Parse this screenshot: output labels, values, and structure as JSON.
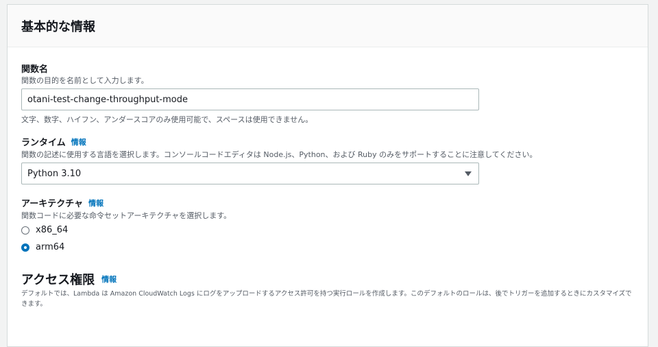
{
  "basic_info": {
    "title": "基本的な情報"
  },
  "function_name": {
    "label": "関数名",
    "description": "関数の目的を名前として入力します。",
    "value": "otani-test-change-throughput-mode",
    "constraint": "文字、数字、ハイフン、アンダースコアのみ使用可能で、スペースは使用できません。"
  },
  "runtime": {
    "label": "ランタイム",
    "info_link": "情報",
    "description": "関数の記述に使用する言語を選択します。コンソールコードエディタは Node.js、Python、および Ruby のみをサポートすることに注意してください。",
    "selected": "Python 3.10"
  },
  "architecture": {
    "label": "アーキテクチャ",
    "info_link": "情報",
    "description": "関数コードに必要な命令セットアーキテクチャを選択します。",
    "options": [
      {
        "label": "x86_64",
        "checked": false
      },
      {
        "label": "arm64",
        "checked": true
      }
    ]
  },
  "permissions": {
    "title": "アクセス権限",
    "info_link": "情報",
    "description": "デフォルトでは、Lambda は Amazon CloudWatch Logs にログをアップロードするアクセス許可を持つ実行ロールを作成します。このデフォルトのロールは、後でトリガーを追加するときにカスタマイズできます。"
  },
  "colors": {
    "link": "#0073bb",
    "radio_selected": "#0073bb"
  }
}
